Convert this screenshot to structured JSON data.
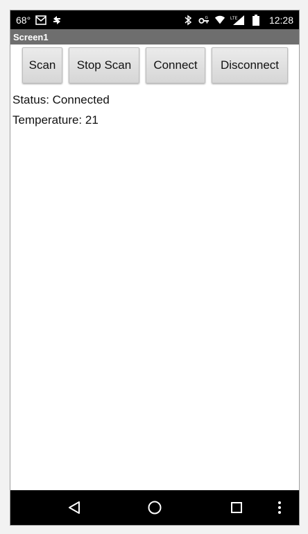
{
  "status_bar": {
    "temperature": "68°",
    "clock": "12:28",
    "network": "LTE",
    "left_icons": [
      "mail-icon",
      "sync-icon"
    ],
    "right_icons": [
      "bluetooth-icon",
      "vpn-key-icon",
      "wifi-icon",
      "cellular-signal-icon",
      "battery-icon"
    ]
  },
  "title_bar": {
    "title": "Screen1"
  },
  "buttons": {
    "scan": "Scan",
    "stop_scan": "Stop Scan",
    "connect": "Connect",
    "disconnect": "Disconnect"
  },
  "labels": {
    "status": "Status: Connected",
    "temperature": "Temperature: 21"
  },
  "nav_bar": {
    "icons": [
      "back-icon",
      "home-icon",
      "recents-icon",
      "overflow-menu-icon"
    ]
  },
  "colors": {
    "status_bar_bg": "#000000",
    "title_bar_bg": "#6e6e6e",
    "button_bg": "#dcdcdc",
    "nav_bar_bg": "#000000"
  }
}
